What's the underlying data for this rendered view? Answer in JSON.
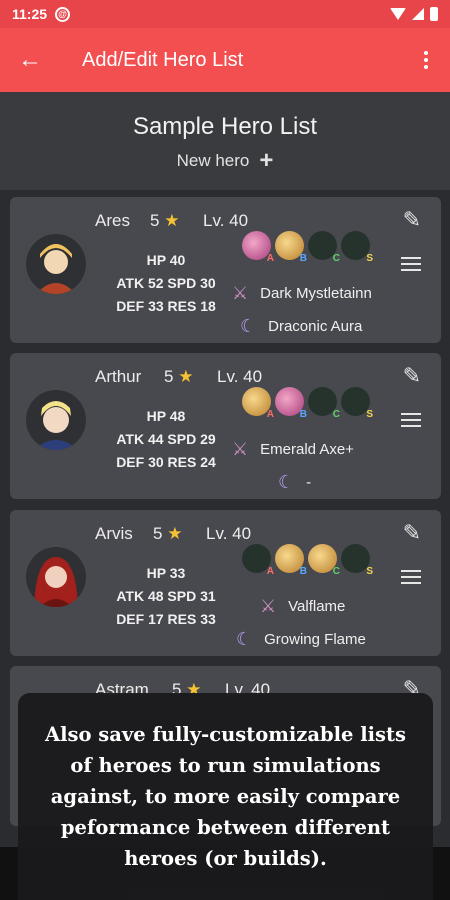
{
  "status": {
    "time": "11:25"
  },
  "appbar": {
    "title": "Add/Edit Hero List"
  },
  "header": {
    "list_title": "Sample Hero List",
    "new_hero": "New hero"
  },
  "heroes": [
    {
      "name": "Ares",
      "rarity": "5",
      "level": "Lv. 40",
      "hp": "HP 40",
      "atk_spd": "ATK 52  SPD 30",
      "def_res": "DEF 33  RES 18",
      "weapon": "Dark Mystletainn",
      "assist": "Draconic Aura",
      "skill_tags": [
        "A",
        "B",
        "C",
        "S"
      ]
    },
    {
      "name": "Arthur",
      "rarity": "5",
      "level": "Lv. 40",
      "hp": "HP 48",
      "atk_spd": "ATK 44  SPD 29",
      "def_res": "DEF 30  RES 24",
      "weapon": "Emerald Axe+",
      "assist": "-",
      "skill_tags": [
        "A",
        "B",
        "C",
        "S"
      ]
    },
    {
      "name": "Arvis",
      "rarity": "5",
      "level": "Lv. 40",
      "hp": "HP 33",
      "atk_spd": "ATK 48  SPD 31",
      "def_res": "DEF 17  RES 33",
      "weapon": "Valflame",
      "assist": "Growing Flame",
      "skill_tags": [
        "A",
        "B",
        "C",
        "S"
      ]
    },
    {
      "name": "Astram",
      "rarity": "5",
      "level": "Lv. 40"
    }
  ],
  "overlay": {
    "caption": "Also save fully-customizable lists of heroes to run simulations against, to more easily compare peformance between different heroes (or builds)."
  }
}
